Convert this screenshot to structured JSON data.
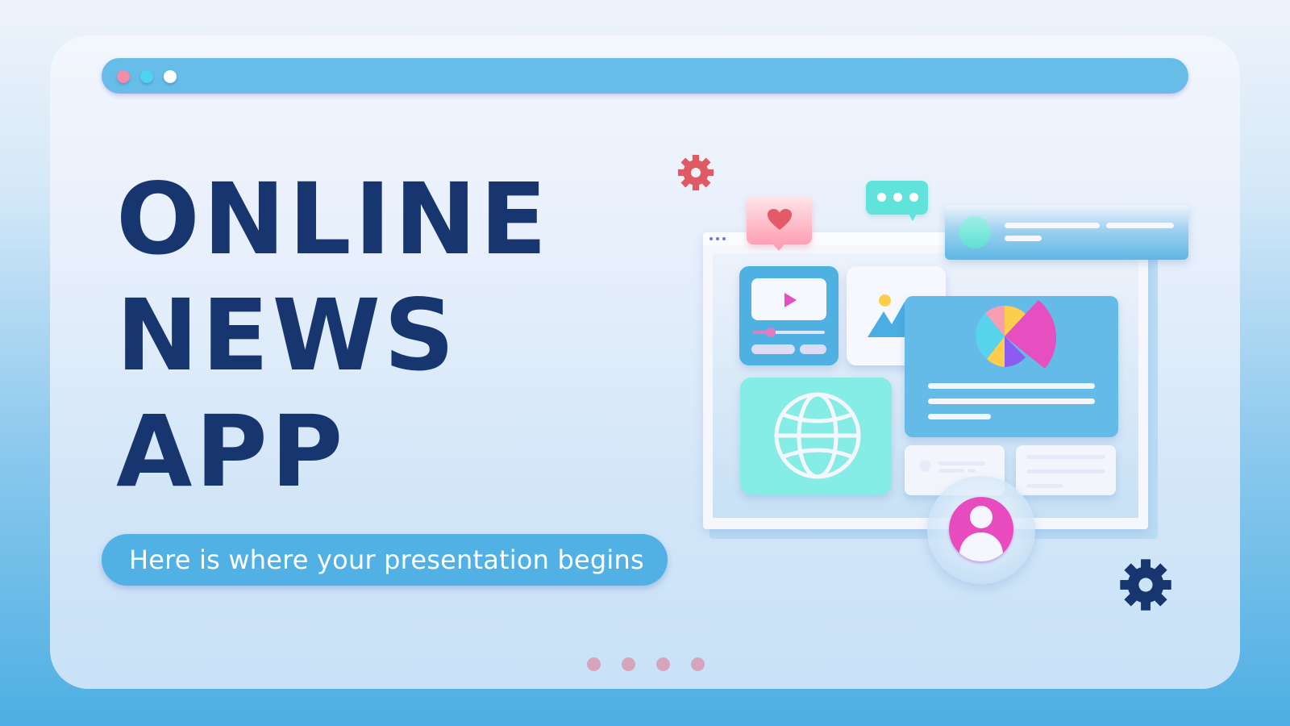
{
  "slide": {
    "title_lines": [
      "ONLINE",
      "NEWS",
      "APP"
    ],
    "subtitle": "Here is where your presentation begins",
    "pager_count": 4
  },
  "window_bar": {
    "controls": [
      {
        "name": "close",
        "color": "#f48ca8"
      },
      {
        "name": "minimize",
        "color": "#4fd3ee"
      },
      {
        "name": "maximize",
        "color": "#ffffff"
      }
    ]
  },
  "illustration": {
    "icons": [
      "gear-icon",
      "heart-icon",
      "chat-bubble-icon",
      "play-icon",
      "mountain-image-icon",
      "globe-icon",
      "pie-chart-icon",
      "user-icon"
    ],
    "video_progress": 0.25
  },
  "colors": {
    "title": "#17356e",
    "accent_blue": "#52b1e4",
    "bar_blue": "#66bde8",
    "pink": "#e74bbd",
    "teal": "#86ece6",
    "gear_red": "#e05a63",
    "gear_navy": "#17356e"
  }
}
